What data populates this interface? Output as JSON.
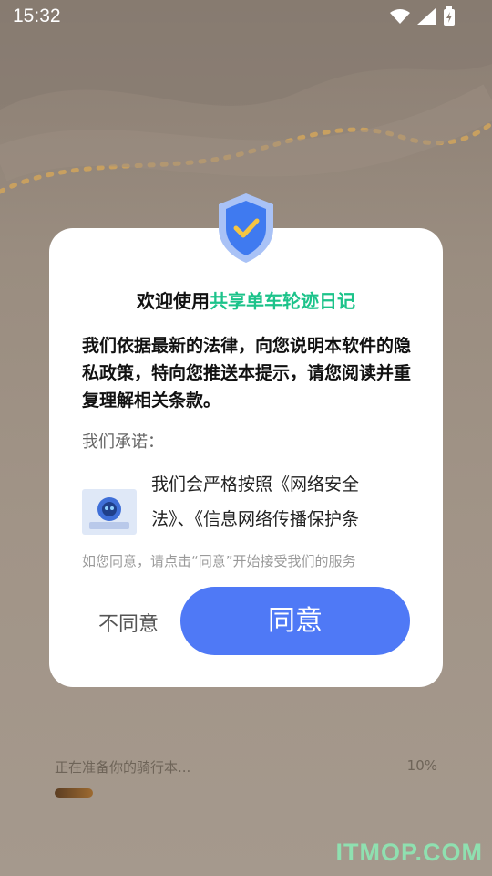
{
  "status_bar": {
    "time": "15:32",
    "icons": [
      "wifi-icon",
      "cellular-signal-icon",
      "battery-charging-icon"
    ]
  },
  "dialog": {
    "title_prefix": "欢迎使用",
    "title_app": "共享单车轮迹日记",
    "body": "我们依据最新的法律，向您说明本软件的隐私政策，特向您推送本提示，请您阅读并重复理解相关条款。",
    "promise_label": "我们承诺：",
    "promise_text": "我们会严格按照《网络安全法》、《信息网络传播保护条",
    "consent_hint": "如您同意，请点击“同意”开始接受我们的服务",
    "disagree_label": "不同意",
    "agree_label": "同意"
  },
  "loading": {
    "label": "正在准备你的骑行本...",
    "percent_text": "10%",
    "progress": 0.1
  },
  "watermark": "ITMOP.COM",
  "colors": {
    "accent": "#4f79f6",
    "app_name": "#1cc38a",
    "dialog_bg": "#ffffff"
  }
}
